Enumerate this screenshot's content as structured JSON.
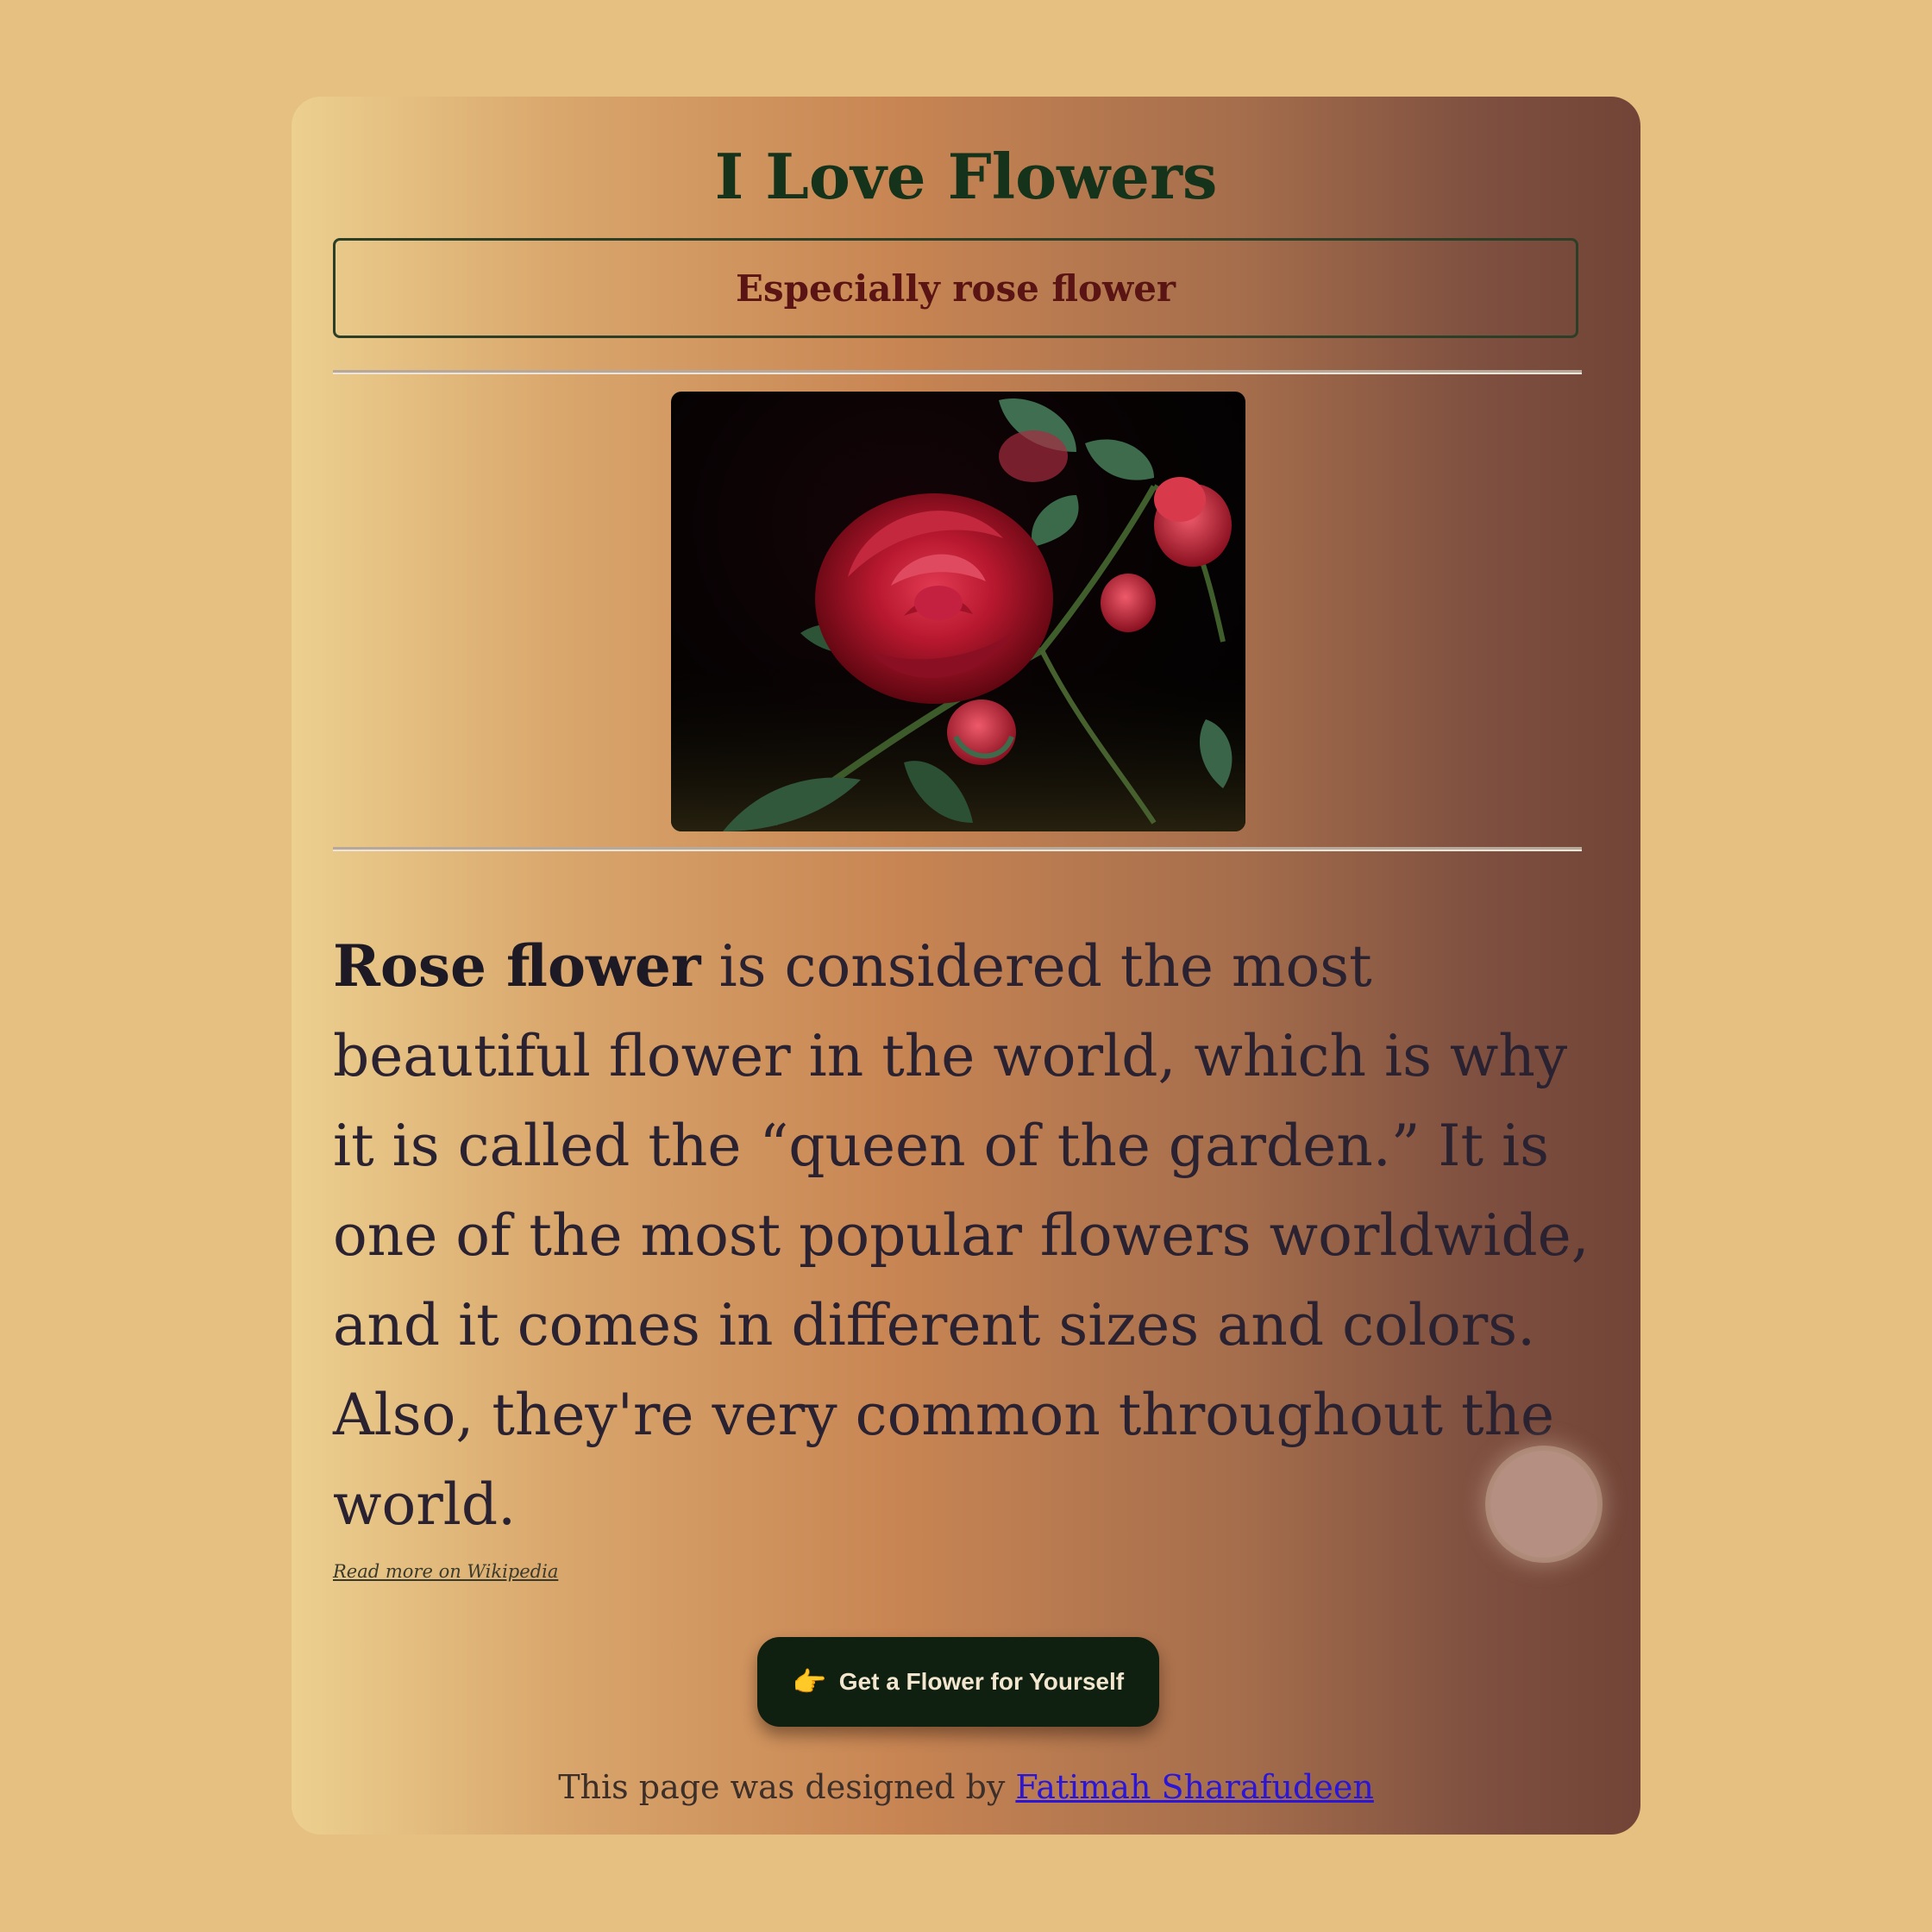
{
  "page": {
    "title": "I Love Flowers",
    "subtitle": "Especially rose flower"
  },
  "content": {
    "lead_bold": "Rose flower",
    "lead_rest": " is considered the most beautiful flower in the world, which is why it is called the “queen of the garden.” It is one of the most popular flowers worldwide, and it comes in different sizes and colors. Also, they're very common throughout the world.",
    "read_more_label": "Read more on Wikipedia"
  },
  "cta": {
    "icon": "👉",
    "label": "Get a Flower for Yourself"
  },
  "footer": {
    "prefix": "This page was designed by ",
    "author": "Fatimah Sharafudeen"
  },
  "colors": {
    "page_background": "#e6c081",
    "title": "#15321a",
    "subtitle": "#5a1414",
    "button_background": "#0f2010",
    "link": "#2b16d8"
  },
  "icons": {
    "cta": "pointing-hand-icon"
  }
}
